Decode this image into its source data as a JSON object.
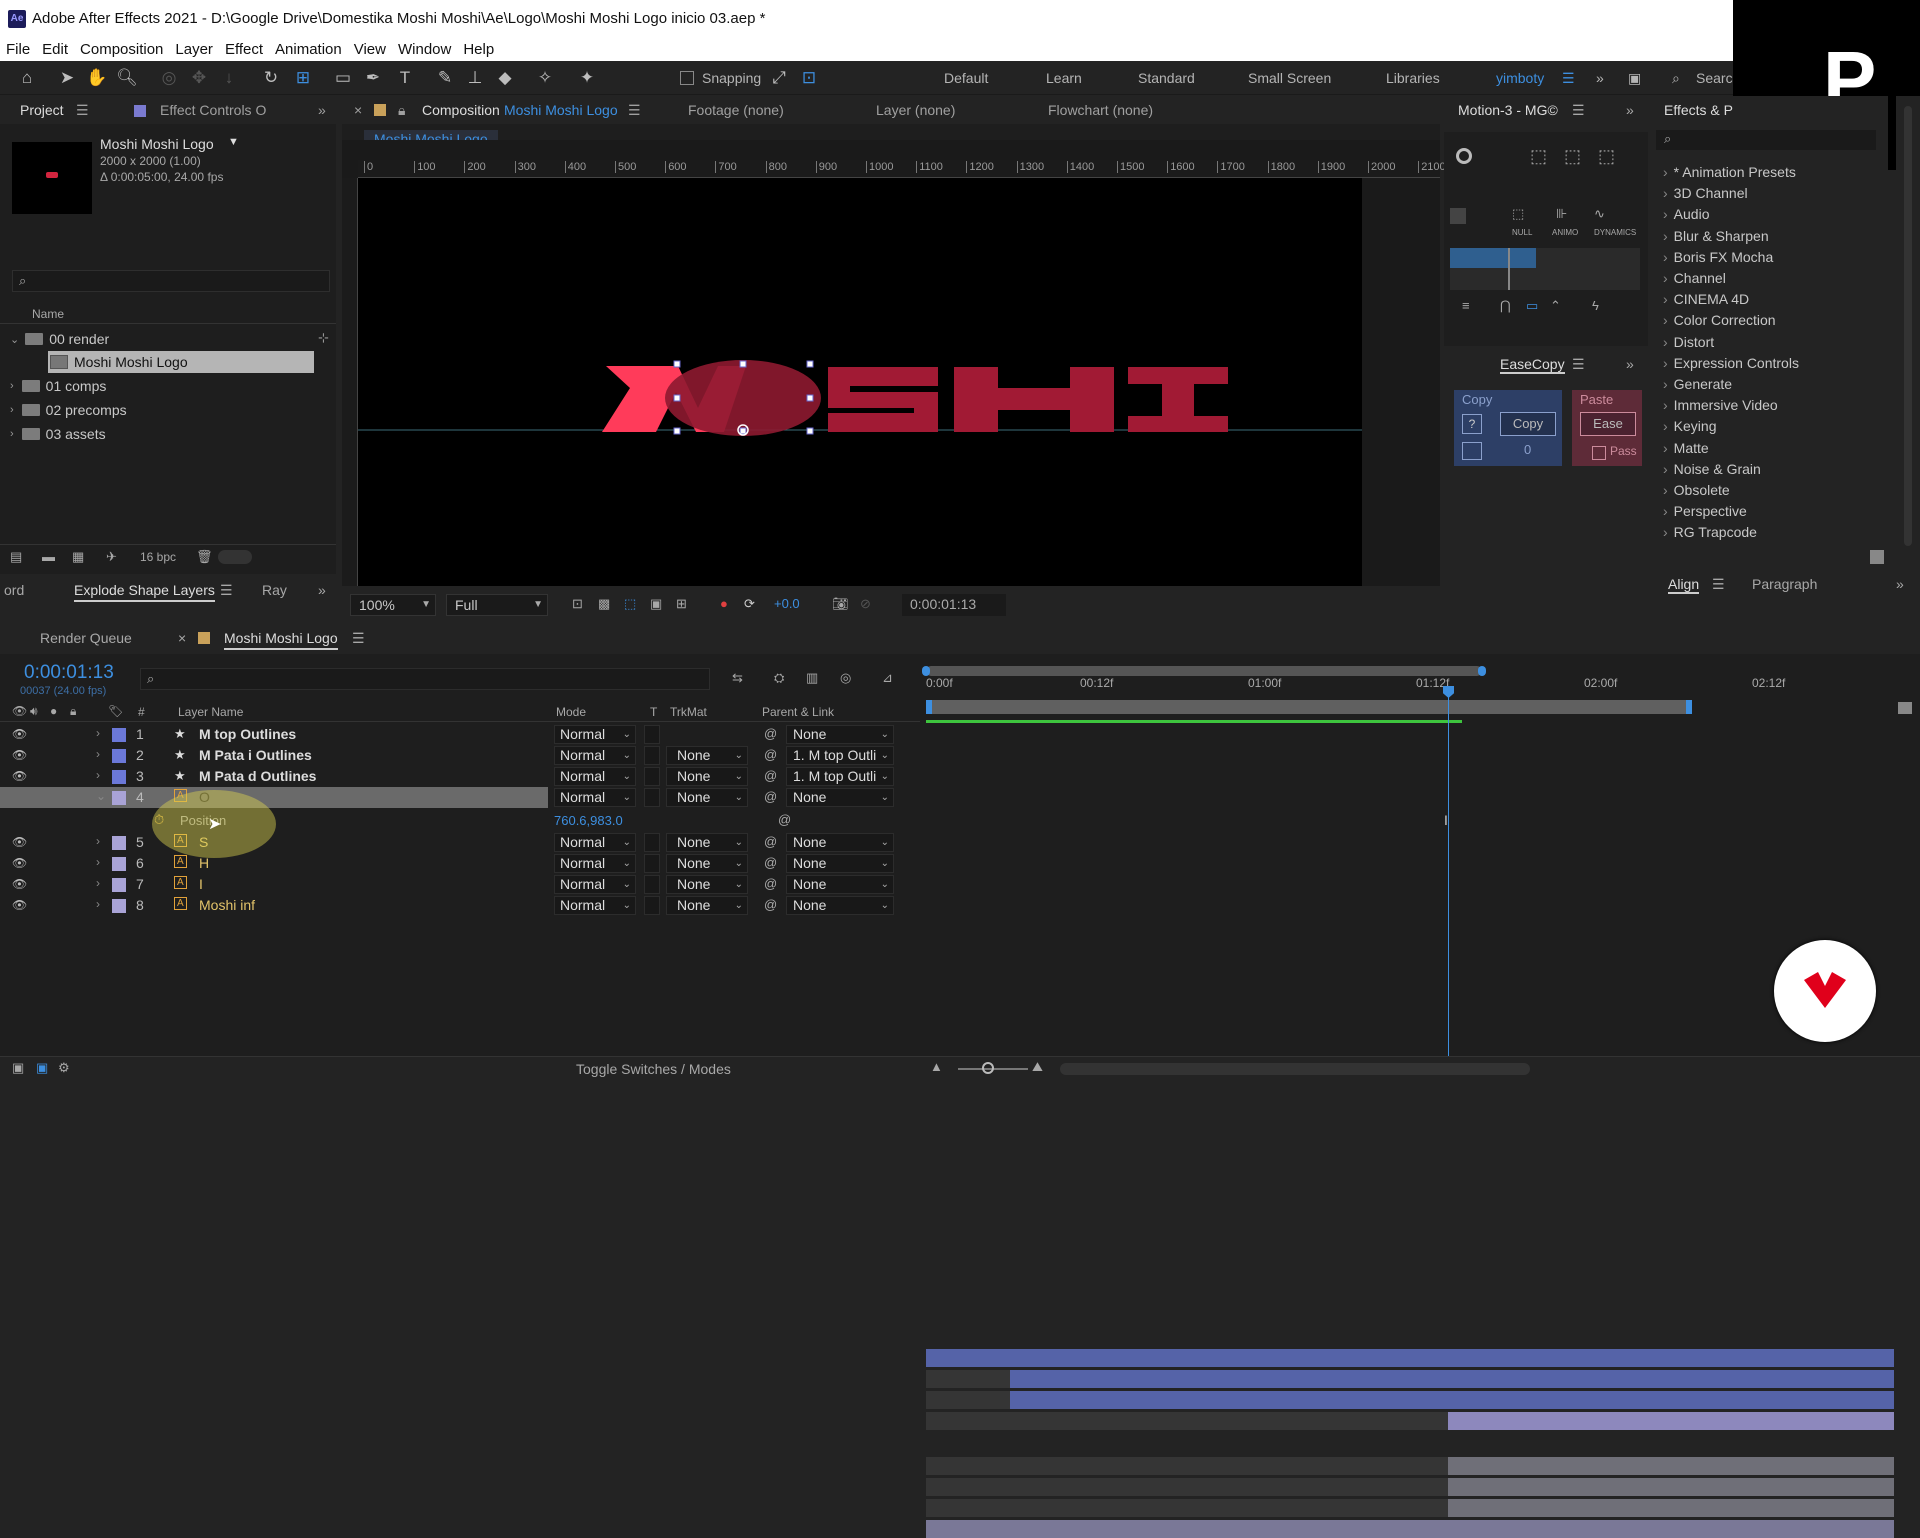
{
  "window": {
    "title": "Adobe After Effects 2021 - D:\\Google Drive\\Domestika Moshi Moshi\\Ae\\Logo\\Moshi Moshi Logo inicio 03.aep *",
    "icon": "Ae"
  },
  "menu": [
    "File",
    "Edit",
    "Composition",
    "Layer",
    "Effect",
    "Animation",
    "View",
    "Window",
    "Help"
  ],
  "toolbar": {
    "snapping": "Snapping",
    "workspaces": [
      "Default",
      "Learn",
      "Standard",
      "Small Screen",
      "Libraries"
    ],
    "active_workspace": "yimboty",
    "search": "Searc"
  },
  "overlay": {
    "letter": "P"
  },
  "project": {
    "tab": "Project",
    "effect_controls": "Effect Controls O",
    "comp_name": "Moshi Moshi Logo",
    "comp_size": "2000 x 2000 (1.00)",
    "comp_duration": "Δ 0:00:05:00, 24.00 fps",
    "name_header": "Name",
    "items": [
      "00 render",
      "Moshi Moshi Logo",
      "01 comps",
      "02 precomps",
      "03 assets"
    ],
    "bpc": "16 bpc"
  },
  "lower_left": {
    "tab_left": "ord",
    "tab_active": "Explode Shape Layers",
    "tab_right": "Ray"
  },
  "comp": {
    "tab_label": "Composition",
    "tab_comp": "Moshi Moshi Logo",
    "footage": "Footage (none)",
    "layer": "Layer (none)",
    "flowchart": "Flowchart (none)",
    "breadcrumb": "Moshi Moshi Logo",
    "ruler": [
      "0",
      "100",
      "200",
      "300",
      "400",
      "500",
      "600",
      "700",
      "800",
      "900",
      "1000",
      "1100",
      "1200",
      "1300",
      "1400",
      "1500",
      "1600",
      "1700",
      "1800",
      "1900",
      "2000",
      "2100"
    ],
    "zoom": "100%",
    "resolution": "Full",
    "exposure": "+0.0",
    "timecode": "0:00:01:13",
    "logo_text": "MOSHI"
  },
  "motion": {
    "tab": "Motion-3 - MG©",
    "labels": [
      "NULL",
      "ANIMO",
      "DYNAMICS"
    ]
  },
  "easecopy": {
    "tab": "EaseCopy",
    "copy_title": "Copy",
    "copy_btn": "Copy",
    "q": "?",
    "count": "0",
    "paste_title": "Paste",
    "paste_btn": "Ease",
    "pass": "Pass"
  },
  "effects": {
    "tab": "Effects & P",
    "items": [
      "* Animation Presets",
      "3D Channel",
      "Audio",
      "Blur & Sharpen",
      "Boris FX Mocha",
      "Channel",
      "CINEMA 4D",
      "Color Correction",
      "Distort",
      "Expression Controls",
      "Generate",
      "Immersive Video",
      "Keying",
      "Matte",
      "Noise & Grain",
      "Obsolete",
      "Perspective",
      "RG Trapcode"
    ]
  },
  "align": {
    "tab": "Align",
    "tab2": "Paragraph"
  },
  "timeline": {
    "render_queue": "Render Queue",
    "tab": "Moshi Moshi Logo",
    "timecode": "0:00:01:13",
    "frames": "00037 (24.00 fps)",
    "headers": {
      "layer_name": "Layer Name",
      "mode": "Mode",
      "t": "T",
      "trkmat": "TrkMat",
      "parent": "Parent & Link",
      "num": "#"
    },
    "ticks": [
      "0:00f",
      "00:12f",
      "01:00f",
      "01:12f",
      "02:00f",
      "02:12f"
    ],
    "toggle": "Toggle Switches / Modes",
    "layers": [
      {
        "num": "1",
        "name": "M top Outlines",
        "type": "shape",
        "mode": "Normal",
        "trkmat": "",
        "parent": "None",
        "color": "#6b78d8"
      },
      {
        "num": "2",
        "name": "M Pata i Outlines",
        "type": "shape",
        "mode": "Normal",
        "trkmat": "None",
        "parent": "1. M top Outli",
        "color": "#6b78d8"
      },
      {
        "num": "3",
        "name": "M Pata d Outlines",
        "type": "shape",
        "mode": "Normal",
        "trkmat": "None",
        "parent": "1. M top Outli",
        "color": "#6b78d8"
      },
      {
        "num": "4",
        "name": "O",
        "type": "ai",
        "mode": "Normal",
        "trkmat": "None",
        "parent": "None",
        "color": "#a9a3d6"
      },
      {
        "num": "5",
        "name": "S",
        "type": "ai",
        "mode": "Normal",
        "trkmat": "None",
        "parent": "None",
        "color": "#a9a3d6"
      },
      {
        "num": "6",
        "name": "H",
        "type": "ai",
        "mode": "Normal",
        "trkmat": "None",
        "parent": "None",
        "color": "#a9a3d6"
      },
      {
        "num": "7",
        "name": "I",
        "type": "ai",
        "mode": "Normal",
        "trkmat": "None",
        "parent": "None",
        "color": "#a9a3d6"
      },
      {
        "num": "8",
        "name": "Moshi inf",
        "type": "ai",
        "mode": "Normal",
        "trkmat": "None",
        "parent": "None",
        "color": "#a9a3d6"
      }
    ],
    "property": {
      "name": "Position",
      "value": "760.6,983.0"
    }
  }
}
